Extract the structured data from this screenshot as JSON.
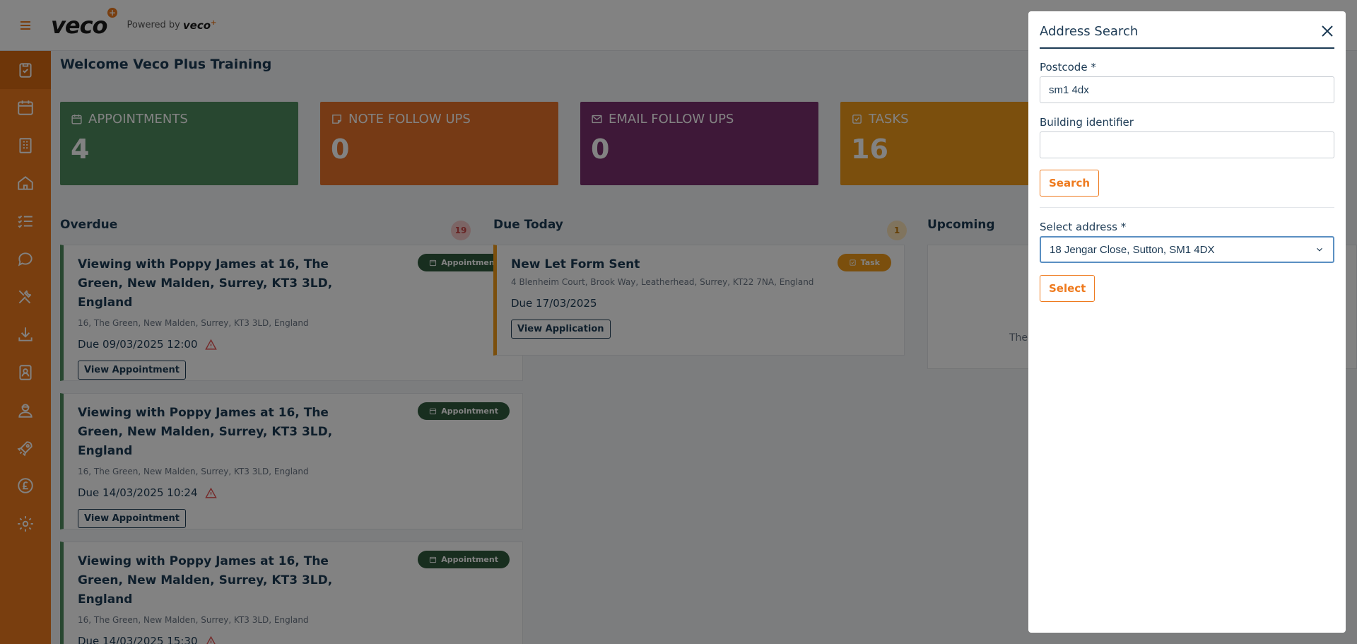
{
  "header": {
    "logo_text": "veco",
    "logo_plus": "+",
    "powered_by": "Powered by",
    "powered_logo": "veco",
    "powered_plus": "+"
  },
  "sidebar": {
    "items": [
      {
        "icon": "clipboard-check-icon",
        "active": true
      },
      {
        "icon": "calendar-icon"
      },
      {
        "icon": "building-icon"
      },
      {
        "icon": "home-icon"
      },
      {
        "icon": "list-check-icon"
      },
      {
        "icon": "chat-icon"
      },
      {
        "icon": "tools-icon"
      },
      {
        "icon": "download-icon"
      },
      {
        "icon": "contact-book-icon"
      },
      {
        "icon": "user-worker-icon"
      },
      {
        "icon": "rocket-icon"
      },
      {
        "icon": "pound-icon"
      },
      {
        "icon": "gear-icon"
      }
    ]
  },
  "main": {
    "welcome": "Welcome Veco Plus Training",
    "stats": [
      {
        "label": "APPOINTMENTS",
        "value": "4",
        "color": "#4f8c5f",
        "icon": "calendar-icon"
      },
      {
        "label": "NOTE FOLLOW UPS",
        "value": "0",
        "color": "#e8732a",
        "icon": "note-icon"
      },
      {
        "label": "EMAIL FOLLOW UPS",
        "value": "0",
        "color": "#7a2f6e",
        "icon": "mail-icon"
      },
      {
        "label": "TASKS",
        "value": "16",
        "color": "#f29b1b",
        "icon": "checkbox-icon"
      }
    ],
    "columns": {
      "overdue": {
        "title": "Overdue",
        "count": "19"
      },
      "due_today": {
        "title": "Due Today",
        "count": "1"
      },
      "upcoming": {
        "title": "Upcoming",
        "empty_text": "The"
      }
    },
    "overdue_cards": [
      {
        "title": "Viewing with Poppy James at 16, The Green, New Malden, Surrey, KT3 3LD, England",
        "address": "16, The Green, New Malden, Surrey, KT3 3LD, England",
        "due": "Due 09/03/2025 12:00",
        "button": "View Appointment",
        "pill": "Appointment"
      },
      {
        "title": "Viewing with Poppy James at 16, The Green, New Malden, Surrey, KT3 3LD, England",
        "address": "16, The Green, New Malden, Surrey, KT3 3LD, England",
        "due": "Due 14/03/2025 10:24",
        "button": "View Appointment",
        "pill": "Appointment"
      },
      {
        "title": "Viewing with Poppy James at 16, The Green, New Malden, Surrey, KT3 3LD, England",
        "address": "16, The Green, New Malden, Surrey, KT3 3LD, England",
        "due": "Due 14/03/2025 15:30",
        "button": "View Appointment",
        "pill": "Appointment"
      }
    ],
    "due_today_card": {
      "title": "New Let Form Sent",
      "address": "4 Blenheim Court, Brook Way, Leatherhead, Surrey, KT22 7NA, England",
      "due": "Due 17/03/2025",
      "button": "View Application",
      "pill": "Task"
    }
  },
  "modal": {
    "title": "Address Search",
    "postcode_label": "Postcode *",
    "postcode_value": "sm1 4dx",
    "building_label": "Building identifier",
    "building_value": "",
    "search_button": "Search",
    "select_label": "Select address *",
    "select_value": "18 Jengar Close, Sutton, SM1 4DX",
    "select_button": "Select"
  },
  "colors": {
    "brand": "#ee7a1e",
    "navy": "#1d3b55",
    "appointment": "#2f5a3d",
    "task": "#f29b1b",
    "overdue_badge": "#f3c6c6"
  }
}
